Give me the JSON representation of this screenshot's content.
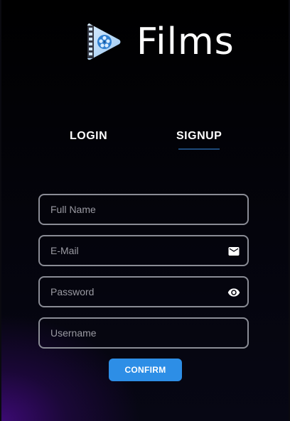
{
  "app": {
    "title": "Films",
    "logo_icon": "film-play-icon",
    "accent": "#2d8ee6"
  },
  "tabs": {
    "login_label": "LOGIN",
    "signup_label": "SIGNUP",
    "active": "SIGNUP"
  },
  "form": {
    "full_name": {
      "placeholder": "Full Name",
      "value": ""
    },
    "email": {
      "placeholder": "E-Mail",
      "value": "",
      "icon": "mail-icon"
    },
    "password": {
      "placeholder": "Password",
      "value": "",
      "icon": "eye-icon"
    },
    "username": {
      "placeholder": "Username",
      "value": ""
    },
    "confirm_label": "CONFIRM"
  }
}
